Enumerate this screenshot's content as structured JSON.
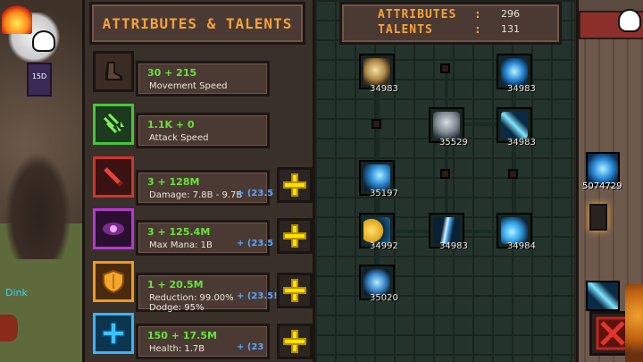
{
  "title": "ATTRIBUTES & TALENTS",
  "stats": {
    "attributes_label": "ATTRIBUTES",
    "attributes_value": "296",
    "talents_label": "TALENTS",
    "talents_value": "131",
    "separator": ":"
  },
  "attributes": [
    {
      "icon": "boot-icon",
      "value": "30 + 215",
      "name": "Movement Speed",
      "extra": "",
      "has_plus": false
    },
    {
      "icon": "arrows-icon",
      "value": "1.1K + 0",
      "name": "Attack Speed",
      "extra": "",
      "has_plus": false
    },
    {
      "icon": "sword-icon",
      "value": "3 + 128M",
      "name": "Damage: 7.8B - 9.7B",
      "extra": "+ (23.5",
      "has_plus": true
    },
    {
      "icon": "eye-icon",
      "value": "3 + 125.4M",
      "name": "Max Mana: 1B",
      "extra": "+ (23.5",
      "has_plus": true
    },
    {
      "icon": "shield-icon",
      "value": "1 + 20.5M",
      "name": "Reduction: 99.00%",
      "name2": "Dodge: 95%",
      "extra": "+ (23.5!",
      "has_plus": true
    },
    {
      "icon": "cross-icon",
      "value": "150 + 17.5M",
      "name": "Health: 1.7B",
      "extra": "+ (23",
      "has_plus": true
    }
  ],
  "talents": [
    {
      "name": "talent-orb-node",
      "value": "34983"
    },
    {
      "name": "talent-frost-burst-node",
      "value": "34983"
    },
    {
      "name": "talent-guardian-node",
      "value": "35529"
    },
    {
      "name": "talent-ice-hammer-node",
      "value": "34983"
    },
    {
      "name": "talent-ice-shard-node",
      "value": "35197"
    },
    {
      "name": "talent-golden-shield-node",
      "value": "34992"
    },
    {
      "name": "talent-lightning-node",
      "value": "34983"
    },
    {
      "name": "talent-frost-orb-node",
      "value": "34984"
    },
    {
      "name": "talent-crystal-node",
      "value": "35020"
    }
  ],
  "hud": {
    "player_name": "Dink",
    "level_badge": "15D",
    "side_counter": "5074729"
  },
  "colors": {
    "accent": "#f6a23a",
    "value_green": "#67e33a",
    "extra_blue": "#5aa6ff",
    "plus_yellow": "#ffe100",
    "close_red": "#c0261d"
  }
}
